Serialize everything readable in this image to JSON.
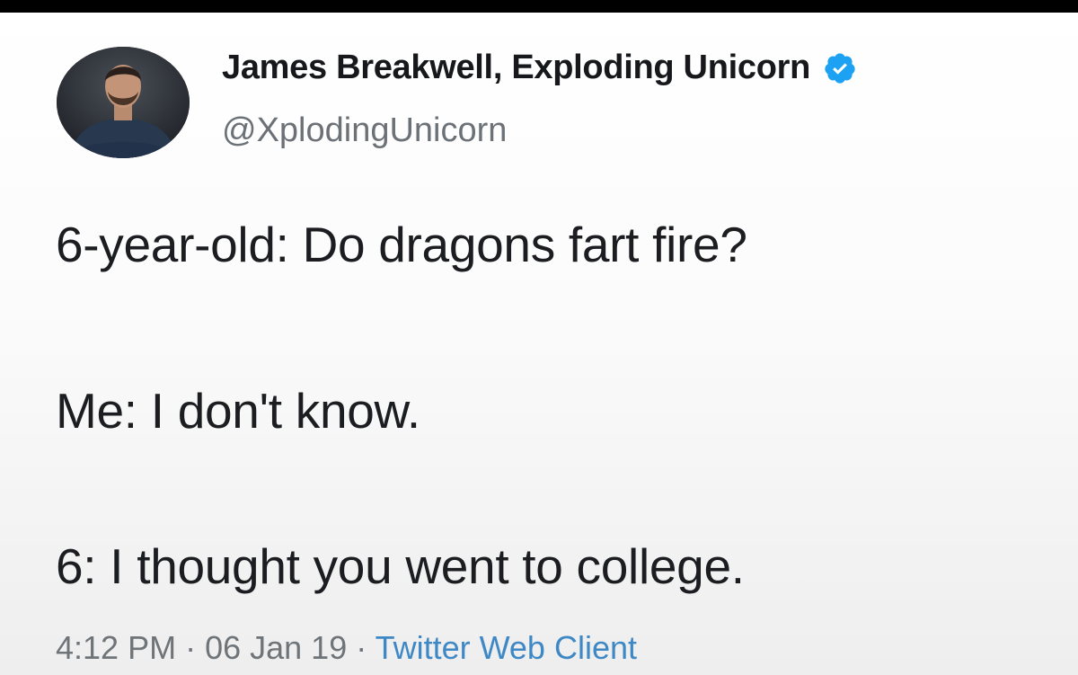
{
  "author": {
    "display_name": "James Breakwell, Exploding Unicorn",
    "handle": "@XplodingUnicorn",
    "avatar_icon": "profile-photo",
    "verified_icon": "verified-badge-icon",
    "verified_color": "#1da1f2"
  },
  "tweet": {
    "lines": [
      "6-year-old: Do dragons fart fire?",
      "Me: I don't know.",
      "6: I thought you went to college."
    ]
  },
  "meta": {
    "time": "4:12 PM",
    "separator": " · ",
    "date": "06 Jan 19",
    "source": "Twitter Web Client",
    "source_color": "#3e88c6"
  }
}
